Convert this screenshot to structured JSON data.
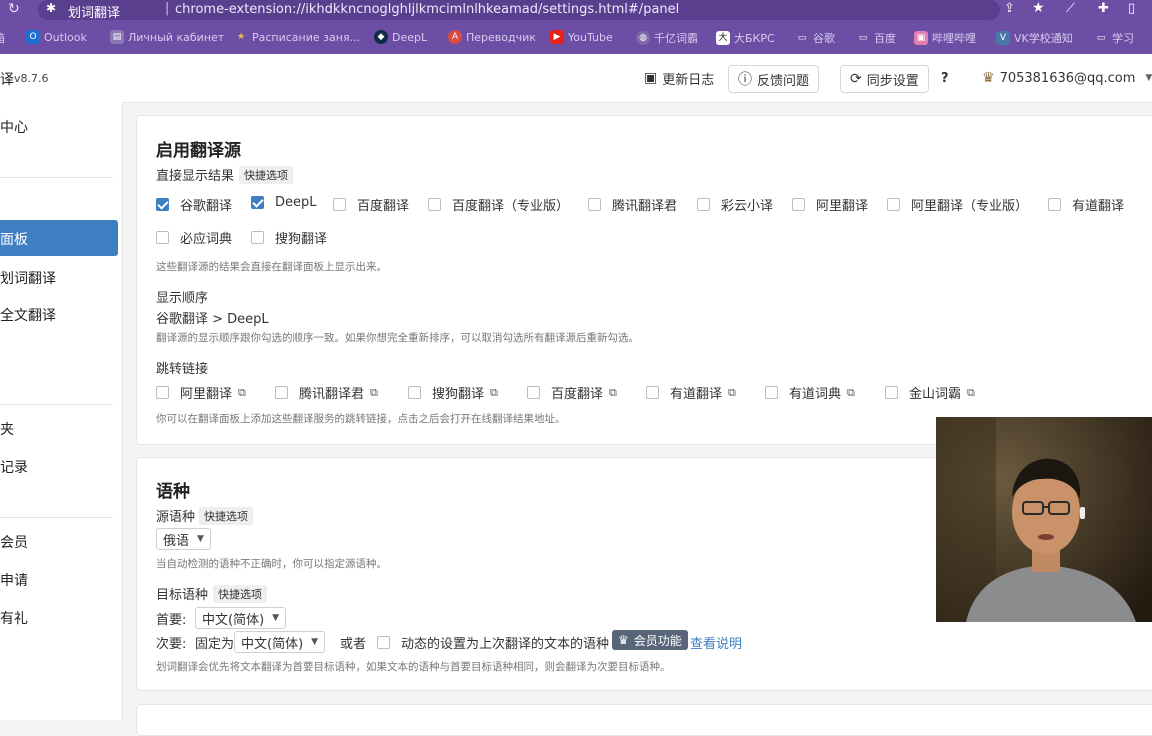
{
  "browser": {
    "tab_title": "划词翻译",
    "url": "chrome-extension://ikhdkkncnoglghljlkmcimlnlhkeamad/settings.html#/panel",
    "bookmarks": [
      {
        "label": "箱",
        "icon": "folder-icon"
      },
      {
        "label": "Outlook",
        "icon": "outlook-icon"
      },
      {
        "label": "Личный кабинет",
        "icon": "page-icon"
      },
      {
        "label": "Расписание заня...",
        "icon": "star-icon"
      },
      {
        "label": "DeepL",
        "icon": "deepl-icon"
      },
      {
        "label": "Переводчик",
        "icon": "translate-icon"
      },
      {
        "label": "YouTube",
        "icon": "youtube-icon"
      },
      {
        "label": "千亿词霸",
        "icon": "globe-icon"
      },
      {
        "label": "大БКРС",
        "icon": "dict-icon"
      },
      {
        "label": "谷歌",
        "icon": "folder-icon"
      },
      {
        "label": "百度",
        "icon": "folder-icon"
      },
      {
        "label": "哔哩哔哩",
        "icon": "bilibili-icon"
      },
      {
        "label": "VK学校通知",
        "icon": "vk-icon"
      },
      {
        "label": "学习",
        "icon": "folder-icon"
      }
    ]
  },
  "app": {
    "title": "译",
    "version": "v8.7.6",
    "changelog": "更新日志",
    "feedback": "反馈问题",
    "sync": "同步设置",
    "help": "?",
    "account": "705381636@qq.com"
  },
  "sidebar": {
    "items": [
      "中心",
      "面板",
      "划词翻译",
      "全文翻译",
      "夹",
      "记录",
      "会员",
      "申请",
      "有礼"
    ],
    "active": "面板"
  },
  "sources": {
    "title": "启用翻译源",
    "direct_label": "直接显示结果",
    "quick": "快捷选项",
    "list": [
      {
        "label": "谷歌翻译",
        "checked": true
      },
      {
        "label": "DeepL",
        "checked": true
      },
      {
        "label": "百度翻译",
        "checked": false
      },
      {
        "label": "百度翻译（专业版）",
        "checked": false
      },
      {
        "label": "腾讯翻译君",
        "checked": false
      },
      {
        "label": "彩云小译",
        "checked": false
      },
      {
        "label": "阿里翻译",
        "checked": false
      },
      {
        "label": "阿里翻译（专业版）",
        "checked": false
      },
      {
        "label": "有道翻译",
        "checked": false
      },
      {
        "label": "必应词典",
        "checked": false
      },
      {
        "label": "搜狗翻译",
        "checked": false
      }
    ],
    "direct_note": "这些翻译源的结果会直接在翻译面板上显示出来。",
    "order_label": "显示顺序",
    "order_value": "谷歌翻译 > DeepL",
    "order_note": "翻译源的显示顺序跟你勾选的顺序一致。如果你想完全重新排序，可以取消勾选所有翻译源后重新勾选。",
    "jump_label": "跳转链接",
    "jump_list": [
      {
        "label": "阿里翻译",
        "checked": false
      },
      {
        "label": "腾讯翻译君",
        "checked": false
      },
      {
        "label": "搜狗翻译",
        "checked": false
      },
      {
        "label": "百度翻译",
        "checked": false
      },
      {
        "label": "有道翻译",
        "checked": false
      },
      {
        "label": "有道词典",
        "checked": false
      },
      {
        "label": "金山词霸",
        "checked": false
      }
    ],
    "jump_note": "你可以在翻译面板上添加这些翻译服务的跳转链接，点击之后会打开在线翻译结果地址。"
  },
  "language": {
    "title": "语种",
    "source_label": "源语种",
    "quick": "快捷选项",
    "source_value": "俄语",
    "source_note": "当自动检测的语种不正确时，你可以指定源语种。",
    "target_label": "目标语种",
    "primary_label": "首要:",
    "primary_value": "中文(简体)",
    "secondary_label": "次要:",
    "fixed_label": "固定为",
    "secondary_value": "中文(简体)",
    "or_label": "或者",
    "dynamic_label": "动态的设置为上次翻译的文本的语种",
    "dynamic_checked": false,
    "vip_badge": "会员功能",
    "details_link": "查看说明",
    "target_note": "划词翻译会优先将文本翻译为首要目标语种，如果文本的语种与首要目标语种相同，则会翻译为次要目标语种。"
  }
}
